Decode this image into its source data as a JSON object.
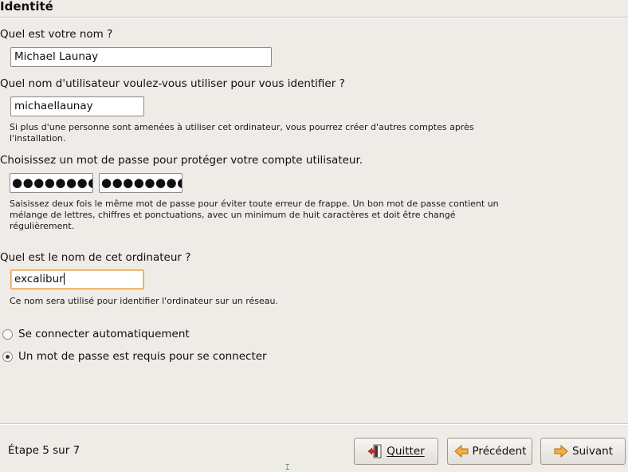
{
  "header": {
    "title": "Identité"
  },
  "form": {
    "name": {
      "question": "Quel est votre nom ?",
      "value": "Michael Launay"
    },
    "username": {
      "question": "Quel nom d'utilisateur voulez-vous utiliser pour vous identifier ?",
      "value": "michaellaunay",
      "hint_line1": "Si plus d'une personne sont amenées à utiliser cet ordinateur, vous pourrez créer d'autres comptes après",
      "hint_line2": "l'installation."
    },
    "password": {
      "question": "Choisissez un mot de passe pour protéger votre compte utilisateur.",
      "value": "●●●●●●●●",
      "confirm_value": "●●●●●●●●",
      "hint_line1": "Saisissez deux fois le même mot de passe pour éviter toute erreur de frappe. Un bon mot de passe contient un",
      "hint_line2": "mélange de lettres, chiffres et ponctuations, avec un minimum de huit caractères et doit être changé",
      "hint_line3": "régulièrement."
    },
    "computer": {
      "question": "Quel est le nom de cet ordinateur ?",
      "value": "excalibur",
      "hint": "Ce nom sera utilisé pour identifier l'ordinateur sur un réseau."
    },
    "login": {
      "auto_label": "Se connecter automatiquement",
      "password_label": "Un mot de passe est requis pour se connecter",
      "selected": "password"
    }
  },
  "footer": {
    "step": "Étape 5 sur 7",
    "quit_label": "Quitter",
    "prev_label": "Précédent",
    "next_label": "Suivant"
  },
  "colors": {
    "focus_border": "#e2a550",
    "background": "#efebe7",
    "arrow": "#f0a030"
  }
}
